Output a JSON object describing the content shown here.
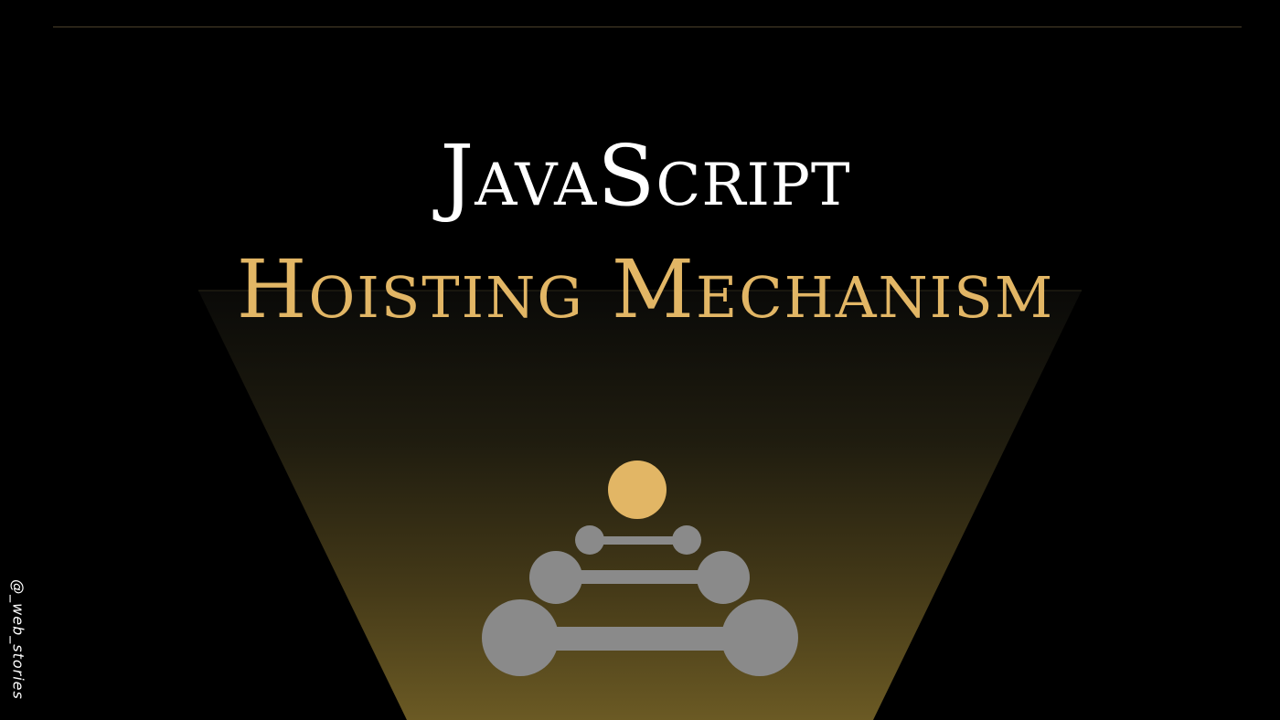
{
  "slide": {
    "title": "JavaScript",
    "subtitle": "Hoisting Mechanism",
    "handle": "@_web_stories"
  },
  "colors": {
    "background": "#000000",
    "title": "#ffffff",
    "accent": "#e2b665",
    "bar": "#8a8a8a",
    "funnel_bottom": "#6b5a24"
  },
  "illustration": {
    "icon": "hoisting-stack-icon"
  }
}
